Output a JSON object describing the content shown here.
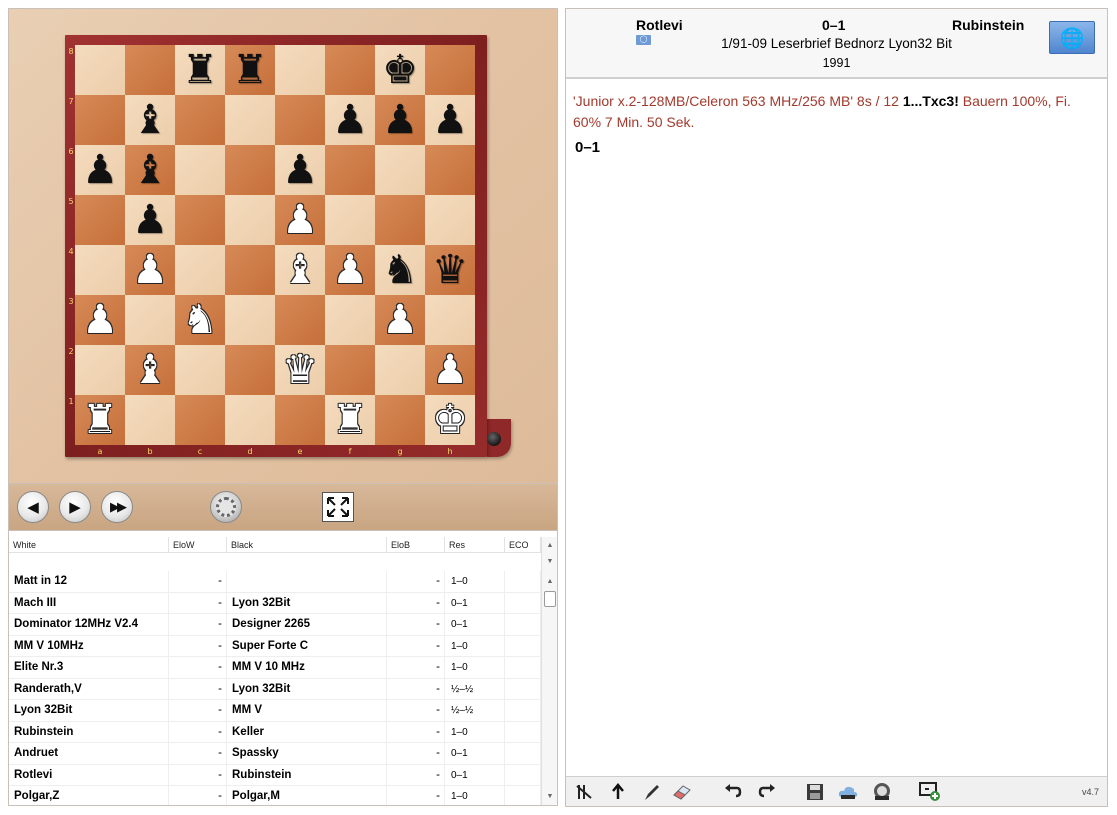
{
  "board": {
    "files": [
      "a",
      "b",
      "c",
      "d",
      "e",
      "f",
      "g",
      "h"
    ],
    "ranks": [
      "8",
      "7",
      "6",
      "5",
      "4",
      "3",
      "2",
      "1"
    ],
    "position": [
      [
        "",
        "",
        "bR",
        "bR",
        "",
        "",
        "bK",
        ""
      ],
      [
        "",
        "bB",
        "",
        "",
        "",
        "bP",
        "bP",
        "bP"
      ],
      [
        "bP",
        "bB",
        "",
        "",
        "bP",
        "",
        "",
        ""
      ],
      [
        "",
        "bP",
        "",
        "",
        "wP",
        "",
        "",
        ""
      ],
      [
        "",
        "wP",
        "",
        "",
        "wB",
        "wP",
        "bN",
        "bQ"
      ],
      [
        "wP",
        "",
        "wN",
        "",
        "",
        "",
        "wP",
        ""
      ],
      [
        "",
        "wB",
        "",
        "",
        "wQ",
        "",
        "",
        "wP"
      ],
      [
        "wR",
        "",
        "",
        "",
        "",
        "wR",
        "",
        "wK"
      ]
    ],
    "colors": {
      "light": "#f2d9bb",
      "dark": "#cf7b45",
      "frame": "#8f2828",
      "coord": "#f5d96b"
    }
  },
  "nav": {
    "back_icon": "arrow-left-icon",
    "forward_icon": "arrow-right-icon",
    "end_icon": "fast-forward-icon",
    "engine_icon": "engine-wheel-icon",
    "fullscreen_icon": "expand-icon"
  },
  "game_list": {
    "columns": {
      "white": "White",
      "elow": "EloW",
      "black": "Black",
      "elob": "EloB",
      "res": "Res",
      "eco": "ECO"
    },
    "rows": [
      {
        "white": "Matt in 12",
        "elow": "-",
        "black": "",
        "elob": "-",
        "res": "1–0",
        "eco": ""
      },
      {
        "white": "Mach III",
        "elow": "-",
        "black": "Lyon 32Bit",
        "elob": "-",
        "res": "0–1",
        "eco": ""
      },
      {
        "white": "Dominator 12MHz V2.4",
        "elow": "-",
        "black": "Designer 2265",
        "elob": "-",
        "res": "0–1",
        "eco": ""
      },
      {
        "white": "MM V 10MHz",
        "elow": "-",
        "black": "Super Forte C",
        "elob": "-",
        "res": "1–0",
        "eco": ""
      },
      {
        "white": "Elite Nr.3",
        "elow": "-",
        "black": "MM V 10 MHz",
        "elob": "-",
        "res": "1–0",
        "eco": ""
      },
      {
        "white": "Randerath,V",
        "elow": "-",
        "black": "Lyon 32Bit",
        "elob": "-",
        "res": "½–½",
        "eco": ""
      },
      {
        "white": "Lyon 32Bit",
        "elow": "-",
        "black": "MM V",
        "elob": "-",
        "res": "½–½",
        "eco": ""
      },
      {
        "white": "Rubinstein",
        "elow": "-",
        "black": "Keller",
        "elob": "-",
        "res": "1–0",
        "eco": ""
      },
      {
        "white": "Andruet",
        "elow": "-",
        "black": "Spassky",
        "elob": "-",
        "res": "0–1",
        "eco": ""
      },
      {
        "white": "Rotlevi",
        "elow": "-",
        "black": "Rubinstein",
        "elob": "-",
        "res": "0–1",
        "eco": ""
      },
      {
        "white": "Polgar,Z",
        "elow": "-",
        "black": "Polgar,M",
        "elob": "-",
        "res": "1–0",
        "eco": ""
      }
    ]
  },
  "game_header": {
    "white": "Rotlevi",
    "result": "0–1",
    "black": "Rubinstein",
    "event": "1/91-09 Leserbrief Bednorz Lyon32 Bit",
    "year": "1991",
    "flag_icon": "un-flag-icon"
  },
  "notation": {
    "comment_prefix": "'Junior x.2-128MB/Celeron 563 MHz/256 MB' 8s / 12 ",
    "move": "1...Txc3!",
    "comment_suffix": " Bauern 100%, Fi. 60% 7 Min. 50 Sek.",
    "final_result": "0–1",
    "comment_color": "#a23a2d"
  },
  "bottom_toolbar": {
    "icons": [
      "delete-variation-icon",
      "promote-variation-icon",
      "annotate-pen-icon",
      "eraser-icon",
      "undo-icon",
      "redo-icon",
      "save-icon",
      "cloud-icon",
      "share-icon",
      "add-window-icon"
    ],
    "version": "v4.7"
  }
}
